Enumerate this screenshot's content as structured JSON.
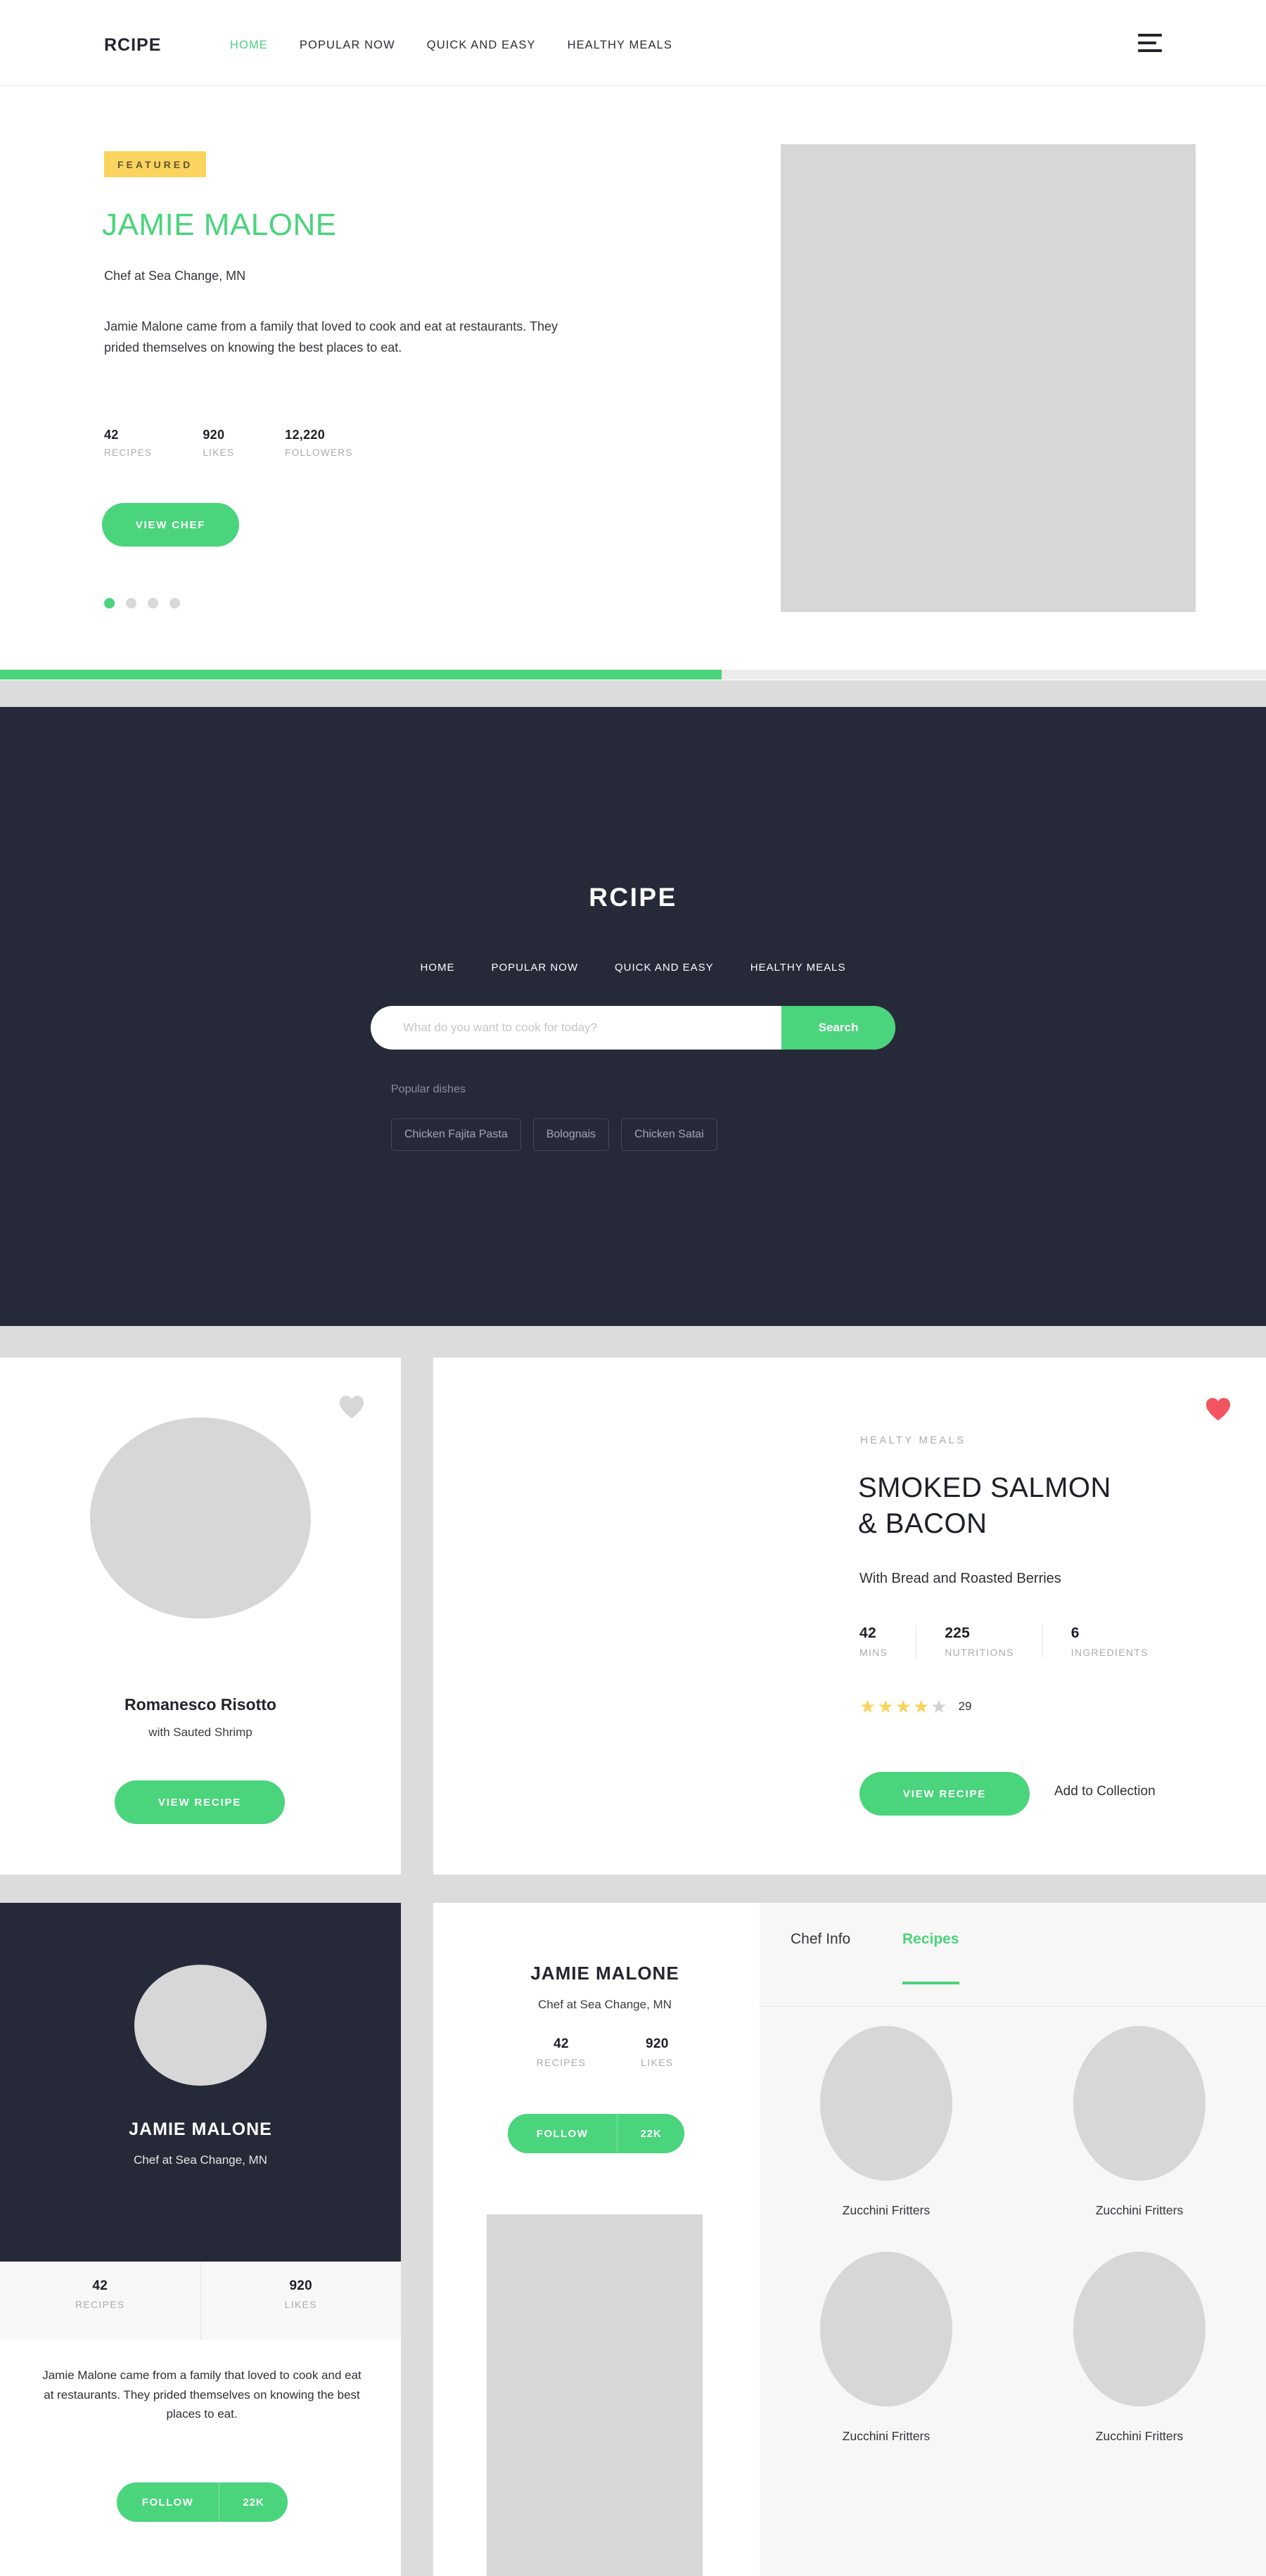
{
  "header": {
    "brand": "RCIPE",
    "nav": [
      {
        "label": "HOME",
        "active": true
      },
      {
        "label": "POPULAR NOW",
        "active": false
      },
      {
        "label": "QUICK AND EASY",
        "active": false
      },
      {
        "label": "HEALTHY MEALS",
        "active": false
      }
    ],
    "menu_icon": "hamburger-icon"
  },
  "hero": {
    "badge": "FEATURED",
    "chef_name": "JAMIE MALONE",
    "chef_role": "Chef at Sea Change, MN",
    "bio": "Jamie Malone came from a family that loved to cook and eat at restaurants. They prided themselves on knowing the best places to eat.",
    "stats": [
      {
        "value": "42",
        "label": "RECIPES"
      },
      {
        "value": "920",
        "label": "LIKES"
      },
      {
        "value": "12,220",
        "label": "FOLLOWERS"
      }
    ],
    "cta": "VIEW CHEF",
    "carousel_dots": 4,
    "active_dot": 1,
    "progress_percent": 57
  },
  "search_section": {
    "logo": "RCIPE",
    "nav": [
      "HOME",
      "POPULAR NOW",
      "QUICK AND EASY",
      "HEALTHY MEALS"
    ],
    "search_placeholder": "What do you want to cook for today?",
    "search_value": "",
    "search_button": "Search",
    "popular_label": "Popular dishes",
    "chips": [
      "Chicken Fajita Pasta",
      "Bolognais",
      "Chicken Satai"
    ]
  },
  "risotto_card": {
    "heart_icon": "heart-outline-icon",
    "title": "Romanesco Risotto",
    "subtitle": "with Sauted Shrimp",
    "cta": "VIEW RECIPE"
  },
  "salmon_card": {
    "heart_icon": "heart-filled-icon",
    "category": "HEALTY MEALS",
    "title_line1": "SMOKED SALMON",
    "title_line2": "& BACON",
    "subtitle": "With Bread and Roasted Berries",
    "stats": [
      {
        "value": "42",
        "label": "MINS"
      },
      {
        "value": "225",
        "label": "NUTRITIONS"
      },
      {
        "value": "6",
        "label": "INGREDIENTS"
      }
    ],
    "rating": 4,
    "rating_max": 5,
    "rating_count": "29",
    "cta": "VIEW RECIPE",
    "secondary_action": "Add to Collection"
  },
  "chef_card_dark": {
    "name": "JAMIE MALONE",
    "role": "Chef at Sea Change, MN",
    "stats": [
      {
        "value": "42",
        "label": "RECIPES"
      },
      {
        "value": "920",
        "label": "LIKES"
      }
    ],
    "bio": "Jamie Malone came from a family that loved to cook and eat at restaurants. They prided themselves on knowing the best places to eat.",
    "follow_label": "FOLLOW",
    "follow_count": "22K"
  },
  "chef_card_mid": {
    "name": "JAMIE MALONE",
    "role": "Chef at Sea Change, MN",
    "stats": [
      {
        "value": "42",
        "label": "RECIPES"
      },
      {
        "value": "920",
        "label": "LIKES"
      }
    ],
    "follow_label": "FOLLOW",
    "follow_count": "22K"
  },
  "recipes_panel": {
    "tabs": [
      {
        "label": "Chef Info",
        "active": false
      },
      {
        "label": "Recipes",
        "active": true
      }
    ],
    "recipes": [
      {
        "name": "Zucchini Fritters"
      },
      {
        "name": "Zucchini Fritters"
      },
      {
        "name": "Zucchini Fritters"
      },
      {
        "name": "Zucchini Fritters"
      }
    ]
  },
  "colors": {
    "accent_green": "#4ad47c",
    "dark_navy": "#262a38",
    "badge_yellow": "#fad45f",
    "heart_red": "#f2555f",
    "star_yellow": "#fad45f",
    "page_bg": "#dcdcdc"
  }
}
